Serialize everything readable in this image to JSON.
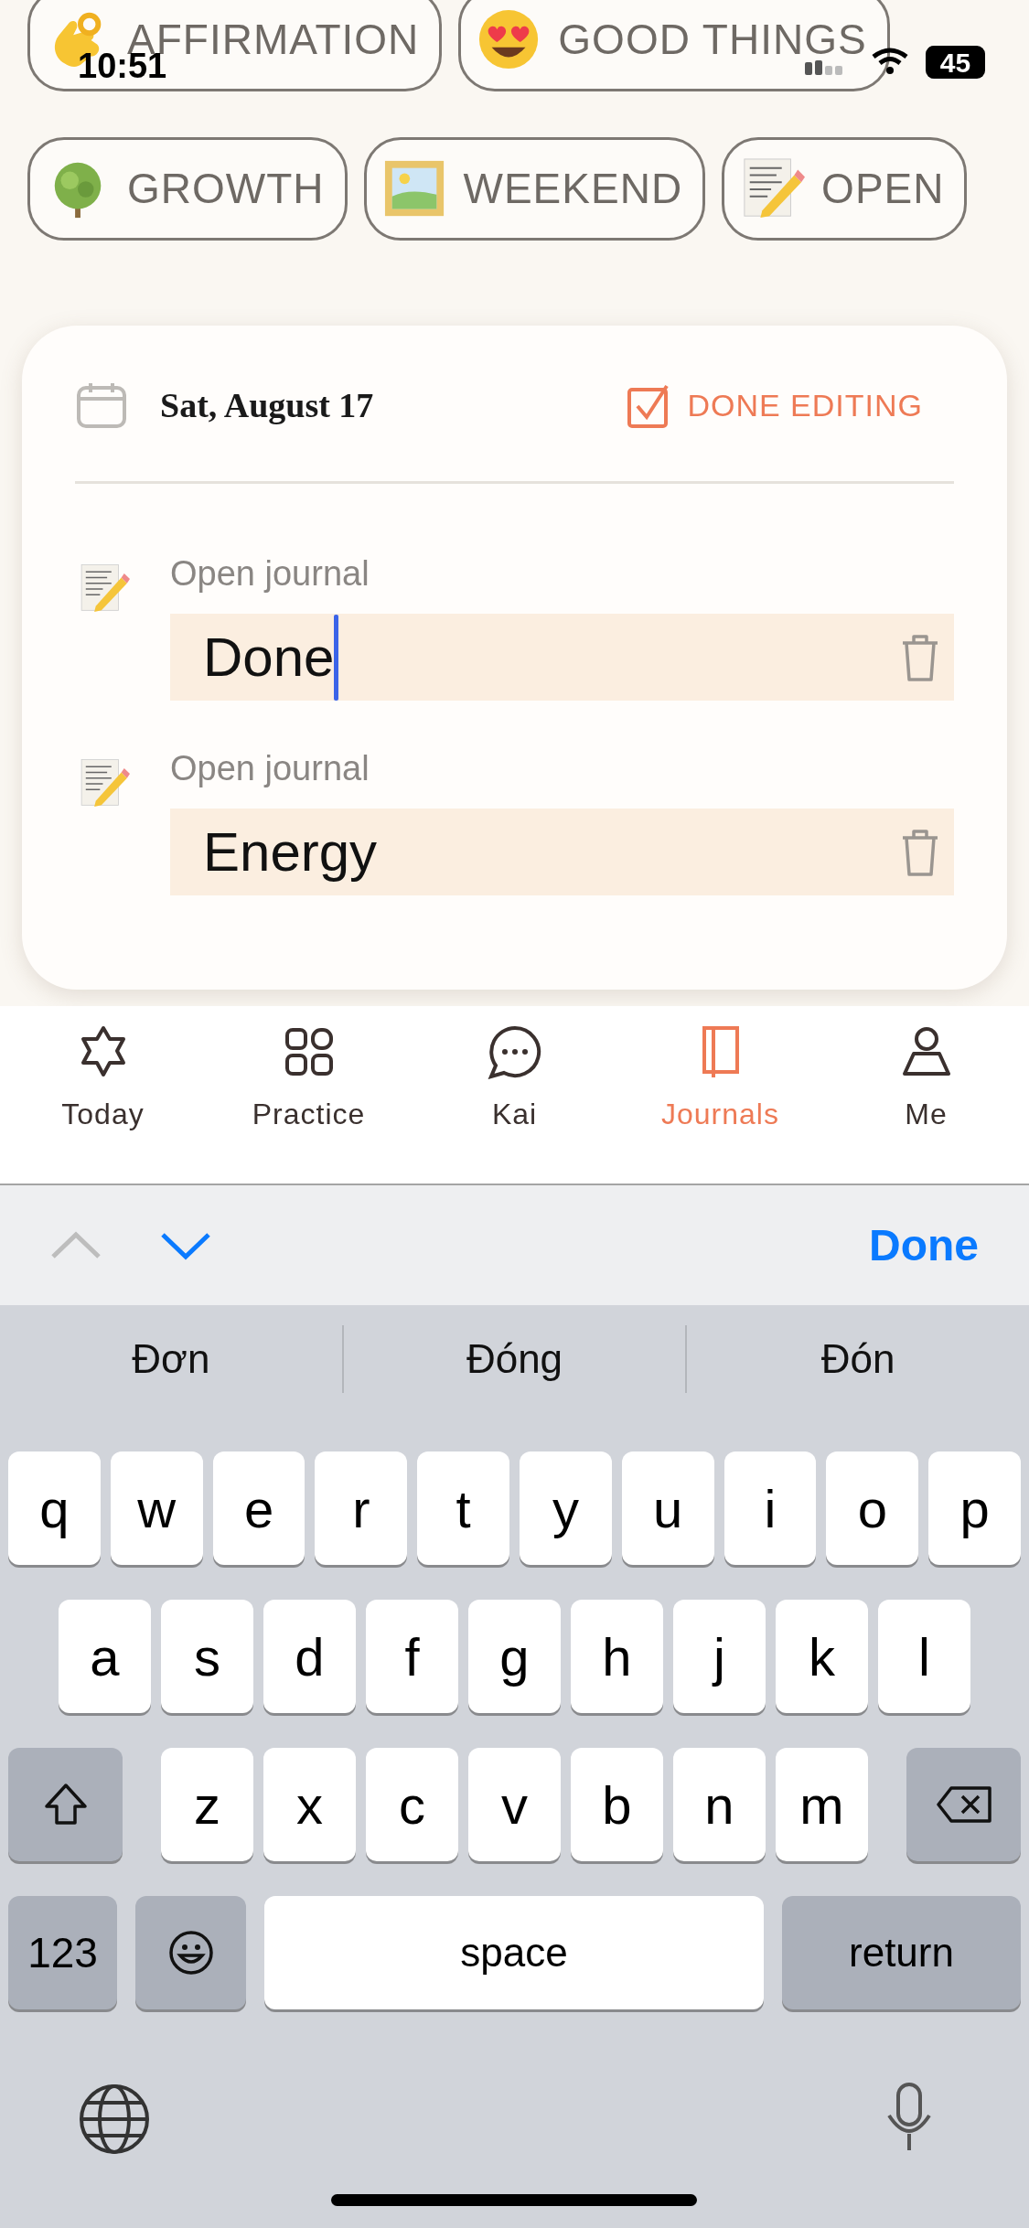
{
  "status_bar": {
    "time": "10:51",
    "battery": "45"
  },
  "chip_rows": [
    [
      {
        "kind": "affirmation",
        "label": "AFFIRMATION"
      },
      {
        "kind": "good-things",
        "label": "GOOD THINGS"
      }
    ],
    [
      {
        "kind": "growth",
        "label": "GROWTH"
      },
      {
        "kind": "weekend",
        "label": "WEEKEND"
      },
      {
        "kind": "open",
        "label": "OPEN"
      }
    ]
  ],
  "card": {
    "date": "Sat, August 17",
    "done_editing": "DONE EDITING",
    "entries": [
      {
        "label": "Open journal",
        "value": "Done",
        "focused": true
      },
      {
        "label": "Open journal",
        "value": "Energy",
        "focused": false
      }
    ]
  },
  "tab_bar": [
    {
      "label": "Today",
      "selected": false
    },
    {
      "label": "Practice",
      "selected": false
    },
    {
      "label": "Kai",
      "selected": false
    },
    {
      "label": "Journals",
      "selected": true
    },
    {
      "label": "Me",
      "selected": false
    }
  ],
  "keyboard_toolbar": {
    "previous_enabled": false,
    "next_enabled": true,
    "done": "Done"
  },
  "suggestions": [
    "Đơn",
    "Đóng",
    "Đón"
  ],
  "keyboard": {
    "rows": [
      [
        "q",
        "w",
        "e",
        "r",
        "t",
        "y",
        "u",
        "i",
        "o",
        "p"
      ],
      [
        "a",
        "s",
        "d",
        "f",
        "g",
        "h",
        "j",
        "k",
        "l"
      ],
      [
        "z",
        "x",
        "c",
        "v",
        "b",
        "n",
        "m"
      ]
    ],
    "numbers": "123",
    "space": "space",
    "return": "return"
  }
}
